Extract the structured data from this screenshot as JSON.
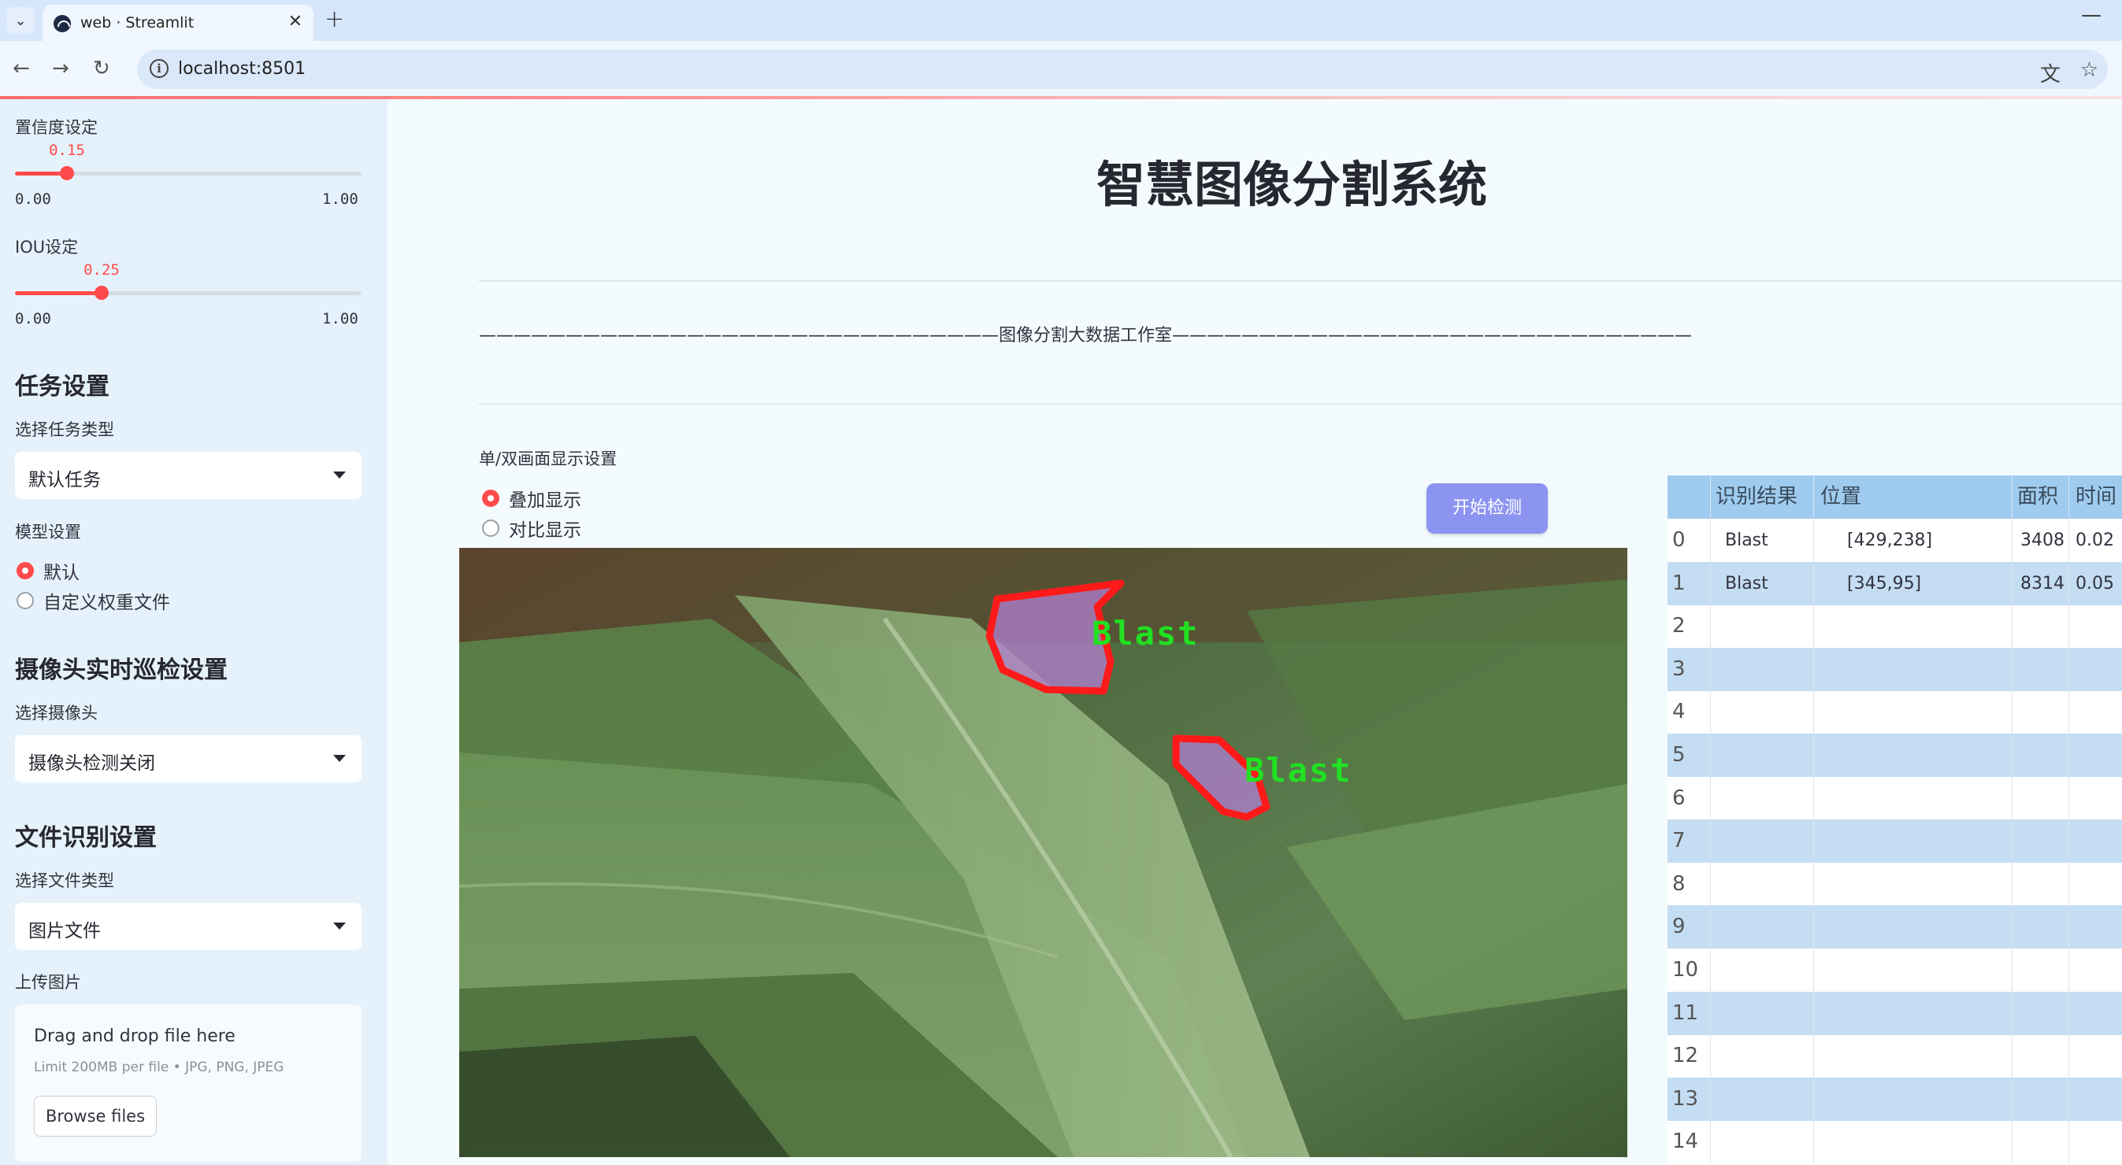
{
  "browser": {
    "tab_title": "web · Streamlit",
    "url": "localhost:8501",
    "icons": [
      "tab-menu-icon",
      "streamlit-favicon",
      "close-icon",
      "plus-icon",
      "minimize-icon",
      "back-icon",
      "forward-icon",
      "reload-icon",
      "info-icon",
      "translate-icon",
      "star-icon"
    ]
  },
  "sidebar": {
    "confidence": {
      "label": "置信度设定",
      "value": "0.15",
      "min": "0.00",
      "max": "1.00",
      "fraction": 0.15
    },
    "iou": {
      "label": "IOU设定",
      "value": "0.25",
      "min": "0.00",
      "max": "1.00",
      "fraction": 0.25
    },
    "task_heading": "任务设置",
    "task_type_label": "选择任务类型",
    "task_type_value": "默认任务",
    "model_label": "模型设置",
    "model_options": [
      "默认",
      "自定义权重文件"
    ],
    "model_selected": "默认",
    "camera_heading": "摄像头实时巡检设置",
    "camera_label": "选择摄像头",
    "camera_value": "摄像头检测关闭",
    "file_heading": "文件识别设置",
    "file_type_label": "选择文件类型",
    "file_type_value": "图片文件",
    "upload_label": "上传图片",
    "upload_title": "Drag and drop file here",
    "upload_hint": "Limit 200MB per file • JPG, PNG, JPEG",
    "upload_button": "Browse files"
  },
  "main": {
    "title": "智慧图像分割系统",
    "studio_line": "——————————————————————————————图像分割大数据工作室——————————————————————————————",
    "display_label": "单/双画面显示设置",
    "display_options": [
      "叠加显示",
      "对比显示"
    ],
    "display_selected": "叠加显示",
    "start_button": "开始检测",
    "detections": [
      {
        "label": "Blast"
      },
      {
        "label": "Blast"
      }
    ]
  },
  "table": {
    "columns": [
      "识别结果",
      "位置",
      "面积",
      "时间"
    ],
    "rows": [
      {
        "index": "0",
        "result": "Blast",
        "position": "[429,238]",
        "area": "3408",
        "time": "0.02"
      },
      {
        "index": "1",
        "result": "Blast",
        "position": "[345,95]",
        "area": "8314",
        "time": "0.05"
      },
      {
        "index": "2",
        "result": "",
        "position": "",
        "area": "",
        "time": ""
      },
      {
        "index": "3",
        "result": "",
        "position": "",
        "area": "",
        "time": ""
      },
      {
        "index": "4",
        "result": "",
        "position": "",
        "area": "",
        "time": ""
      },
      {
        "index": "5",
        "result": "",
        "position": "",
        "area": "",
        "time": ""
      },
      {
        "index": "6",
        "result": "",
        "position": "",
        "area": "",
        "time": ""
      },
      {
        "index": "7",
        "result": "",
        "position": "",
        "area": "",
        "time": ""
      },
      {
        "index": "8",
        "result": "",
        "position": "",
        "area": "",
        "time": ""
      },
      {
        "index": "9",
        "result": "",
        "position": "",
        "area": "",
        "time": ""
      },
      {
        "index": "10",
        "result": "",
        "position": "",
        "area": "",
        "time": ""
      },
      {
        "index": "11",
        "result": "",
        "position": "",
        "area": "",
        "time": ""
      },
      {
        "index": "12",
        "result": "",
        "position": "",
        "area": "",
        "time": ""
      },
      {
        "index": "13",
        "result": "",
        "position": "",
        "area": "",
        "time": ""
      },
      {
        "index": "14",
        "result": "",
        "position": "",
        "area": "",
        "time": ""
      }
    ]
  },
  "colors": {
    "accent": "#ff4b4b",
    "sidebar_bg": "#e6f2fb",
    "button": "#8b94f0",
    "mask_outline": "#ff1a1a",
    "mask_fill": "#b37fd1",
    "label_text": "#22e022"
  }
}
